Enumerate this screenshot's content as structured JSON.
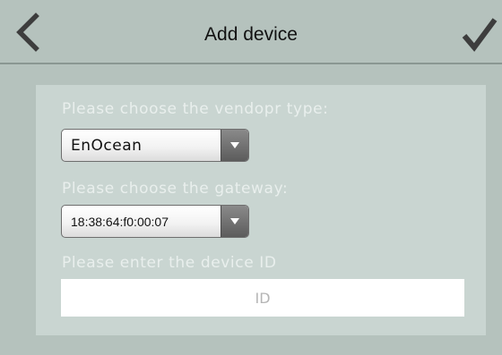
{
  "header": {
    "title": "Add device",
    "back_icon": "chevron-left-icon",
    "done_icon": "checkmark-icon"
  },
  "form": {
    "vendor_label": "Please choose the vendopr type:",
    "vendor_value": "EnOcean",
    "gateway_label": "Please choose the gateway:",
    "gateway_value": "18:38:64:f0:00:07",
    "device_id_label": "Please enter the device ID",
    "device_id_placeholder": "ID",
    "device_id_value": ""
  },
  "colors": {
    "background": "#b5c2bd",
    "panel": "#c9d5d1",
    "label_text": "#e9efed",
    "icon": "#3d3d3d"
  }
}
